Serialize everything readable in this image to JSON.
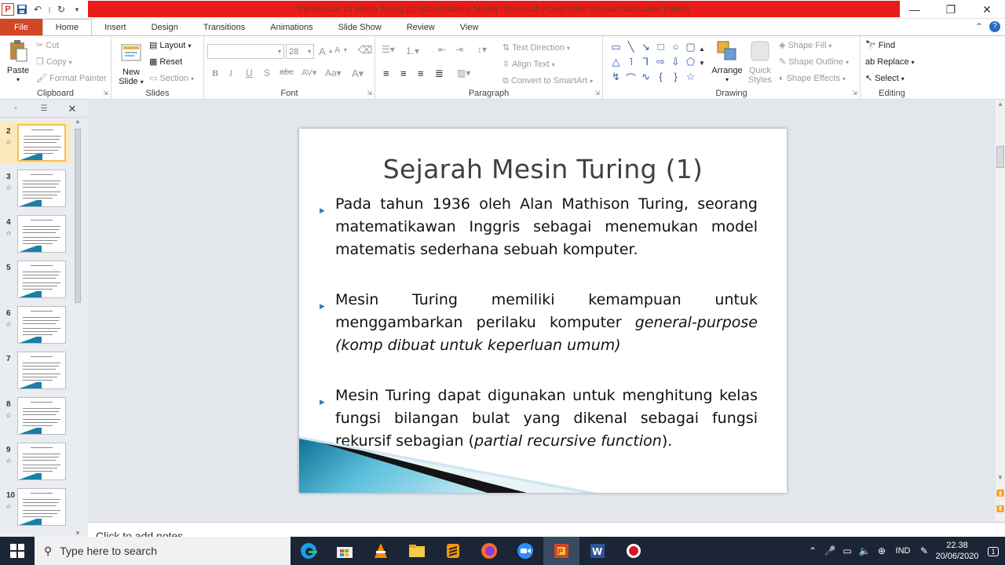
{
  "window": {
    "title": "Pertemuan 13 Mesin Turing (1) [Compatibility Mode]  -  Microsoft PowerPoint (Product Activation Failed)",
    "app_icon": "P"
  },
  "tabs": [
    "File",
    "Home",
    "Insert",
    "Design",
    "Transitions",
    "Animations",
    "Slide Show",
    "Review",
    "View"
  ],
  "ribbon": {
    "clipboard": {
      "paste": "Paste",
      "cut": "Cut",
      "copy": "Copy",
      "format_painter": "Format Painter",
      "label": "Clipboard"
    },
    "slides": {
      "new_slide_1": "New",
      "new_slide_2": "Slide",
      "layout": "Layout",
      "reset": "Reset",
      "section": "Section",
      "label": "Slides"
    },
    "font": {
      "size": "28",
      "label": "Font"
    },
    "paragraph": {
      "text_direction": "Text Direction",
      "align_text": "Align Text",
      "convert_smartart": "Convert to SmartArt",
      "label": "Paragraph"
    },
    "drawing": {
      "arrange": "Arrange",
      "quick_styles_1": "Quick",
      "quick_styles_2": "Styles",
      "shape_fill": "Shape Fill",
      "shape_outline": "Shape Outline",
      "shape_effects": "Shape Effects",
      "label": "Drawing"
    },
    "editing": {
      "find": "Find",
      "replace": "Replace",
      "select": "Select",
      "label": "Editing"
    }
  },
  "thumbnails": [
    {
      "num": "2",
      "star": "☆",
      "selected": true
    },
    {
      "num": "3",
      "star": "☆",
      "selected": false
    },
    {
      "num": "4",
      "star": "☆",
      "selected": false
    },
    {
      "num": "5",
      "star": "",
      "selected": false
    },
    {
      "num": "6",
      "star": "☆",
      "selected": false
    },
    {
      "num": "7",
      "star": "",
      "selected": false
    },
    {
      "num": "8",
      "star": "☆",
      "selected": false
    },
    {
      "num": "9",
      "star": "☆",
      "selected": false
    },
    {
      "num": "10",
      "star": "☆",
      "selected": false
    }
  ],
  "slide": {
    "title": "Sejarah Mesin Turing (1)",
    "bullet1": "Pada tahun 1936 oleh Alan Mathison Turing, seorang matematikawan Inggris sebagai menemukan model matematis sederhana sebuah komputer.",
    "bullet2_a": "Mesin Turing memiliki kemampuan untuk menggambarkan perilaku komputer ",
    "bullet2_b": "general-purpose (komp dibuat untuk keperluan umum)",
    "bullet3_a": "Mesin Turing dapat digunakan untuk menghitung kelas fungsi bilangan bulat yang dikenal sebagai fungsi rekursif sebagian (",
    "bullet3_b": "partial recursive function",
    "bullet3_c": ")."
  },
  "notes_placeholder": "Click to add notes",
  "taskbar": {
    "search_placeholder": "Type here to search",
    "language": "IND",
    "time": "22.38",
    "date": "20/06/2020",
    "notification_count": "1"
  }
}
